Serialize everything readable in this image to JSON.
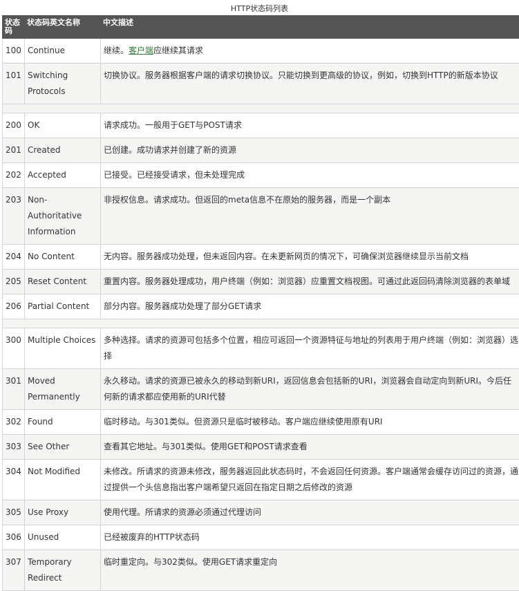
{
  "caption": "HTTP状态码列表",
  "headers": {
    "code": "状态码",
    "name": "状态码英文名称",
    "desc": "中文描述"
  },
  "groups": [
    [
      {
        "code": "100",
        "name": "Continue",
        "desc": "继续。客户端应继续其请求",
        "link": "客户端"
      },
      {
        "code": "101",
        "name": "Switching Protocols",
        "desc": "切换协议。服务器根据客户端的请求切换协议。只能切换到更高级的协议，例如，切换到HTTP的新版本协议"
      }
    ],
    [
      {
        "code": "200",
        "name": "OK",
        "desc": "请求成功。一般用于GET与POST请求"
      },
      {
        "code": "201",
        "name": "Created",
        "desc": "已创建。成功请求并创建了新的资源"
      },
      {
        "code": "202",
        "name": "Accepted",
        "desc": "已接受。已经接受请求，但未处理完成"
      },
      {
        "code": "203",
        "name": "Non-Authoritative Information",
        "desc": "非授权信息。请求成功。但返回的meta信息不在原始的服务器，而是一个副本"
      },
      {
        "code": "204",
        "name": "No Content",
        "desc": "无内容。服务器成功处理，但未返回内容。在未更新网页的情况下，可确保浏览器继续显示当前文档"
      },
      {
        "code": "205",
        "name": "Reset Content",
        "desc": "重置内容。服务器处理成功，用户终端（例如：浏览器）应重置文档视图。可通过此返回码清除浏览器的表单域"
      },
      {
        "code": "206",
        "name": "Partial Content",
        "desc": "部分内容。服务器成功处理了部分GET请求"
      }
    ],
    [
      {
        "code": "300",
        "name": "Multiple Choices",
        "desc": "多种选择。请求的资源可包括多个位置，相应可返回一个资源特征与地址的列表用于用户终端（例如：浏览器）选择"
      },
      {
        "code": "301",
        "name": "Moved Permanently",
        "desc": "永久移动。请求的资源已被永久的移动到新URI，返回信息会包括新的URI，浏览器会自动定向到新URI。今后任何新的请求都应使用新的URI代替"
      },
      {
        "code": "302",
        "name": "Found",
        "desc": "临时移动。与301类似。但资源只是临时被移动。客户端应继续使用原有URI"
      },
      {
        "code": "303",
        "name": "See Other",
        "desc": "查看其它地址。与301类似。使用GET和POST请求查看"
      },
      {
        "code": "304",
        "name": "Not Modified",
        "desc": "未修改。所请求的资源未修改，服务器返回此状态码时，不会返回任何资源。客户端通常会缓存访问过的资源，通过提供一个头信息指出客户端希望只返回在指定日期之后修改的资源"
      },
      {
        "code": "305",
        "name": "Use Proxy",
        "desc": "使用代理。所请求的资源必须通过代理访问"
      },
      {
        "code": "306",
        "name": "Unused",
        "desc": "已经被废弃的HTTP状态码"
      },
      {
        "code": "307",
        "name": "Temporary Redirect",
        "desc": "临时重定向。与302类似。使用GET请求重定向"
      }
    ]
  ]
}
